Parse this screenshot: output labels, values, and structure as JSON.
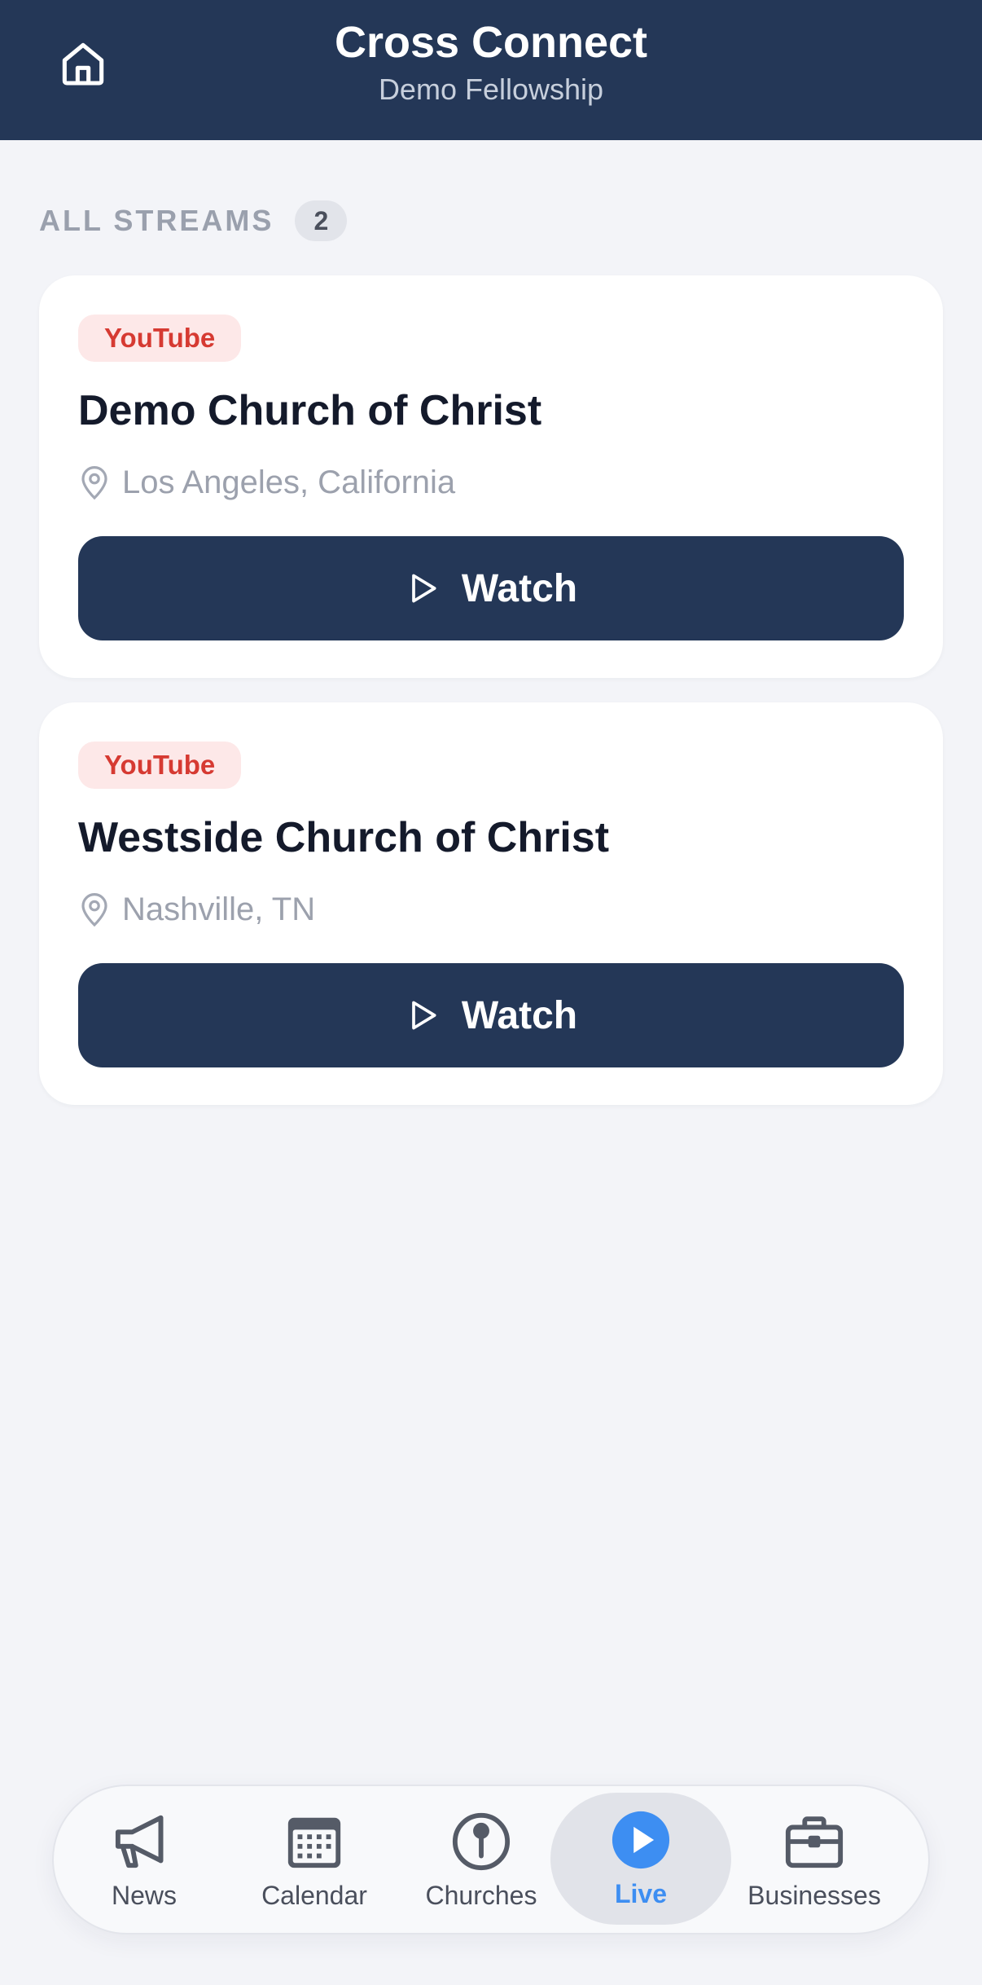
{
  "header": {
    "title": "Cross Connect",
    "subtitle": "Demo Fellowship",
    "home_icon": "home-icon"
  },
  "section": {
    "label": "ALL STREAMS",
    "count": "2"
  },
  "streams": [
    {
      "platform": "YouTube",
      "name": "Demo Church of Christ",
      "location": "Los Angeles, California",
      "watch_label": "Watch"
    },
    {
      "platform": "YouTube",
      "name": "Westside Church of Christ",
      "location": "Nashville, TN",
      "watch_label": "Watch"
    }
  ],
  "tabs": [
    {
      "label": "News",
      "icon": "megaphone-icon"
    },
    {
      "label": "Calendar",
      "icon": "calendar-icon"
    },
    {
      "label": "Churches",
      "icon": "pin-icon"
    },
    {
      "label": "Live",
      "icon": "play-circle-icon",
      "active": true
    },
    {
      "label": "Businesses",
      "icon": "briefcase-icon"
    }
  ],
  "colors": {
    "header_bg": "#243757",
    "page_bg": "#f3f4f8",
    "accent": "#3d8ef2",
    "youtube_red": "#d63a32",
    "youtube_badge_bg": "#fde8e8",
    "button_bg": "#243757"
  }
}
